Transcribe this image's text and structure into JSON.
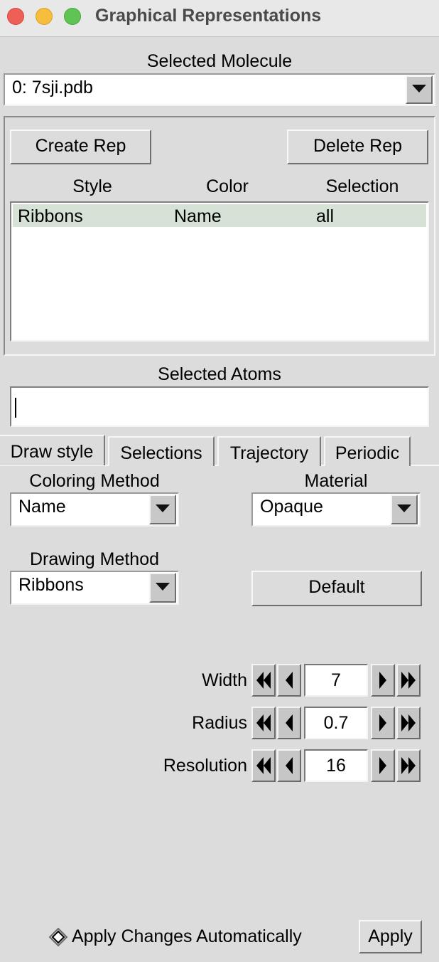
{
  "window": {
    "title": "Graphical Representations"
  },
  "molecule": {
    "label": "Selected Molecule",
    "selected": "0: 7sji.pdb"
  },
  "reps": {
    "create_label": "Create Rep",
    "delete_label": "Delete Rep",
    "columns": [
      "Style",
      "Color",
      "Selection"
    ],
    "rows": [
      {
        "style": "Ribbons",
        "color": "Name",
        "selection": "all"
      }
    ]
  },
  "selected_atoms": {
    "label": "Selected Atoms",
    "value": ""
  },
  "tabs": [
    {
      "label": "Draw style",
      "active": true
    },
    {
      "label": "Selections",
      "active": false
    },
    {
      "label": "Trajectory",
      "active": false
    },
    {
      "label": "Periodic",
      "active": false
    }
  ],
  "draw_style": {
    "coloring_label": "Coloring Method",
    "coloring_value": "Name",
    "material_label": "Material",
    "material_value": "Opaque",
    "drawing_label": "Drawing Method",
    "drawing_value": "Ribbons",
    "default_label": "Default",
    "params": [
      {
        "label": "Width",
        "value": "7"
      },
      {
        "label": "Radius",
        "value": "0.7"
      },
      {
        "label": "Resolution",
        "value": "16"
      }
    ]
  },
  "footer": {
    "auto_apply_label": "Apply Changes Automatically",
    "auto_apply_checked": false,
    "apply_label": "Apply"
  },
  "colors": {
    "selected_row": "#d6e2d6",
    "close": "#ee5f57",
    "minimize": "#f6be3c",
    "zoom": "#5fc453"
  },
  "icons": [
    "close-icon",
    "minimize-icon",
    "zoom-icon",
    "chevron-down-icon",
    "double-left-arrow-icon",
    "left-arrow-icon",
    "right-arrow-icon",
    "double-right-arrow-icon",
    "diamond-check-icon"
  ]
}
